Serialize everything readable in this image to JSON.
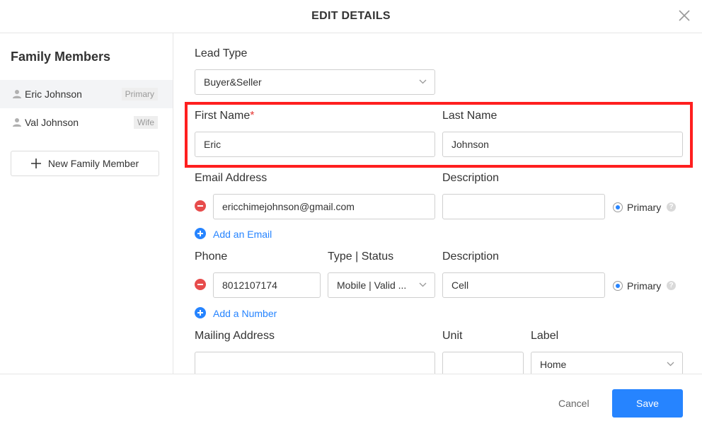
{
  "dialog": {
    "title": "EDIT DETAILS"
  },
  "sidebar": {
    "title": "Family Members",
    "members": [
      {
        "name": "Eric Johnson",
        "tag": "Primary"
      },
      {
        "name": "Val Johnson",
        "tag": "Wife"
      }
    ],
    "new_member_label": "New Family Member"
  },
  "form": {
    "lead_type": {
      "label": "Lead Type",
      "value": "Buyer&Seller"
    },
    "first_name": {
      "label": "First Name",
      "required_mark": "*",
      "value": "Eric"
    },
    "last_name": {
      "label": "Last Name",
      "value": "Johnson"
    },
    "email": {
      "label": "Email Address",
      "description_label": "Description",
      "value": "ericchimejohnson@gmail.com",
      "description_value": "",
      "primary_label": "Primary",
      "add_label": "Add an Email"
    },
    "phone": {
      "label": "Phone",
      "type_label": "Type | Status",
      "description_label": "Description",
      "value": "8012107174",
      "type_value": "Mobile | Valid ...",
      "description_value": "Cell",
      "primary_label": "Primary",
      "add_label": "Add a Number"
    },
    "mailing": {
      "label": "Mailing Address",
      "unit_label": "Unit",
      "label_label": "Label",
      "address_value": "",
      "unit_value": "",
      "label_value": "Home"
    }
  },
  "footer": {
    "cancel_label": "Cancel",
    "save_label": "Save"
  },
  "colors": {
    "accent": "#2684ff",
    "danger": "#e74c4c",
    "highlight": "#ff1f1f"
  }
}
